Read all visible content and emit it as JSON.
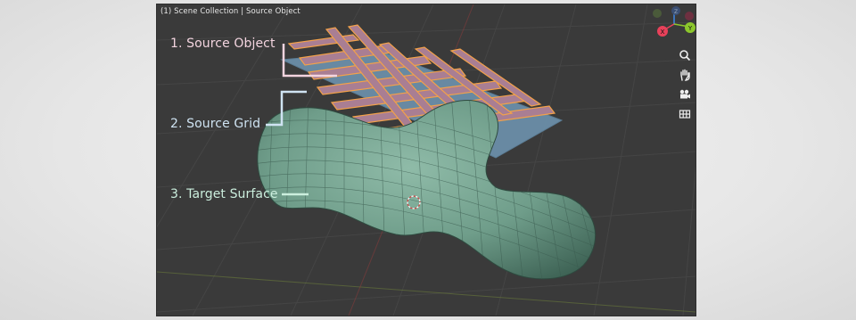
{
  "viewport": {
    "breadcrumb": "(1) Scene Collection | Source Object"
  },
  "callouts": [
    {
      "label": "1. Source Object",
      "color": "#f3d4df"
    },
    {
      "label": "2. Source Grid",
      "color": "#cfe3f2"
    },
    {
      "label": "3. Target Surface",
      "color": "#cbeedd"
    }
  ],
  "gizmo": {
    "x_label": "X",
    "y_label": "Y",
    "z_label": "Z",
    "x_color": "#e8415a",
    "y_color": "#8cc72c",
    "z_color": "#3d88e8"
  },
  "nav_tools": [
    {
      "icon": "zoom-icon"
    },
    {
      "icon": "hand-pan-icon"
    },
    {
      "icon": "camera-icon"
    },
    {
      "icon": "grid-view-icon"
    }
  ],
  "colors": {
    "viewport_bg": "#3a3a3a",
    "grid_line": "#444444",
    "source_object": "#a97e93",
    "source_object_outline": "#f2a14a",
    "source_grid": "#6b8ea8",
    "target_surface": "#6f9d8a"
  }
}
